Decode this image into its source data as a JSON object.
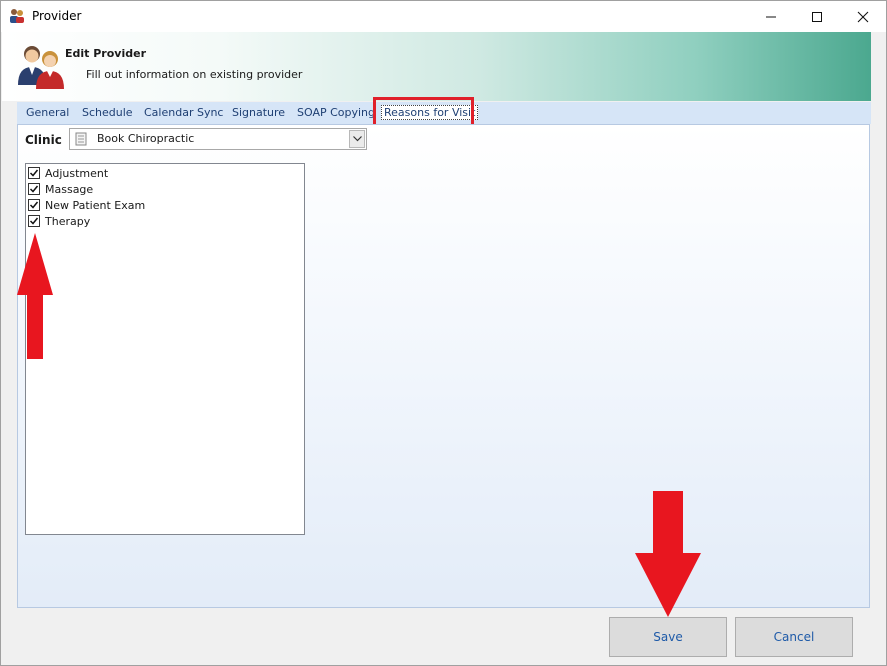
{
  "window": {
    "title": "Provider"
  },
  "header": {
    "title": "Edit Provider",
    "subtitle": "Fill out information on existing provider"
  },
  "tabs": [
    {
      "label": "General"
    },
    {
      "label": "Schedule"
    },
    {
      "label": "Calendar Sync"
    },
    {
      "label": "Signature"
    },
    {
      "label": "SOAP Copying"
    },
    {
      "label": "Reasons for Visit",
      "active": true
    }
  ],
  "clinic": {
    "label": "Clinic",
    "selected": "Book Chiropractic"
  },
  "reasons": [
    {
      "label": "Adjustment",
      "checked": true
    },
    {
      "label": "Massage",
      "checked": true
    },
    {
      "label": "New Patient Exam",
      "checked": true
    },
    {
      "label": "Therapy",
      "checked": true
    }
  ],
  "buttons": {
    "save": "Save",
    "cancel": "Cancel"
  },
  "colors": {
    "annotation": "#e0202a",
    "accent_teal": "#4ba88f",
    "tab_text": "#1e3f73"
  }
}
